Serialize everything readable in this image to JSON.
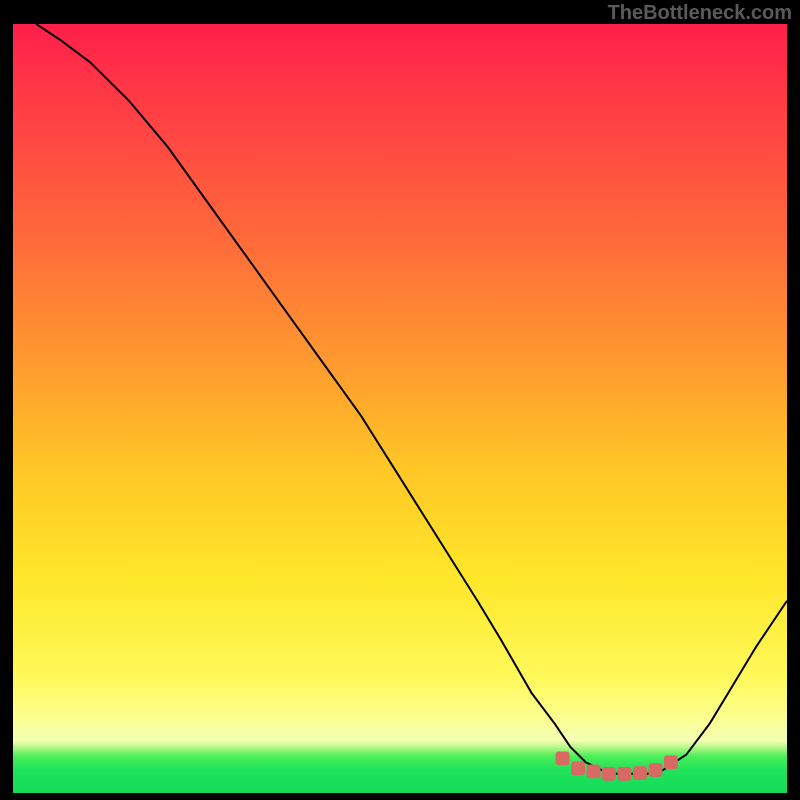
{
  "watermark": "TheBottleneck.com",
  "chart_data": {
    "type": "line",
    "title": "",
    "xlabel": "",
    "ylabel": "",
    "xlim": [
      0,
      100
    ],
    "ylim": [
      0,
      100
    ],
    "grid": false,
    "legend": false,
    "series": [
      {
        "name": "bottleneck-curve",
        "x": [
          3,
          6,
          10,
          15,
          20,
          25,
          30,
          35,
          40,
          45,
          50,
          55,
          60,
          63,
          67,
          70,
          72,
          74,
          76,
          78,
          80,
          82,
          84,
          87,
          90,
          93,
          96,
          100
        ],
        "y": [
          100,
          98,
          95,
          90,
          84,
          77,
          70,
          63,
          56,
          49,
          41,
          33,
          25,
          20,
          13,
          9,
          6,
          4,
          3,
          2.5,
          2.5,
          2.5,
          3,
          5,
          9,
          14,
          19,
          25
        ]
      }
    ],
    "markers": {
      "name": "optimal-band",
      "x": [
        71,
        73,
        75,
        77,
        79,
        81,
        83,
        85
      ],
      "y": [
        4.5,
        3.2,
        2.8,
        2.5,
        2.5,
        2.6,
        3.0,
        4.0
      ],
      "color": "#d86a63",
      "size": 9
    },
    "background_gradient": {
      "top": "#ff1f4a",
      "upper_mid": "#ff9a2f",
      "mid": "#ffe72a",
      "lower": "#fdff8e",
      "bottom": "#13da58"
    }
  }
}
